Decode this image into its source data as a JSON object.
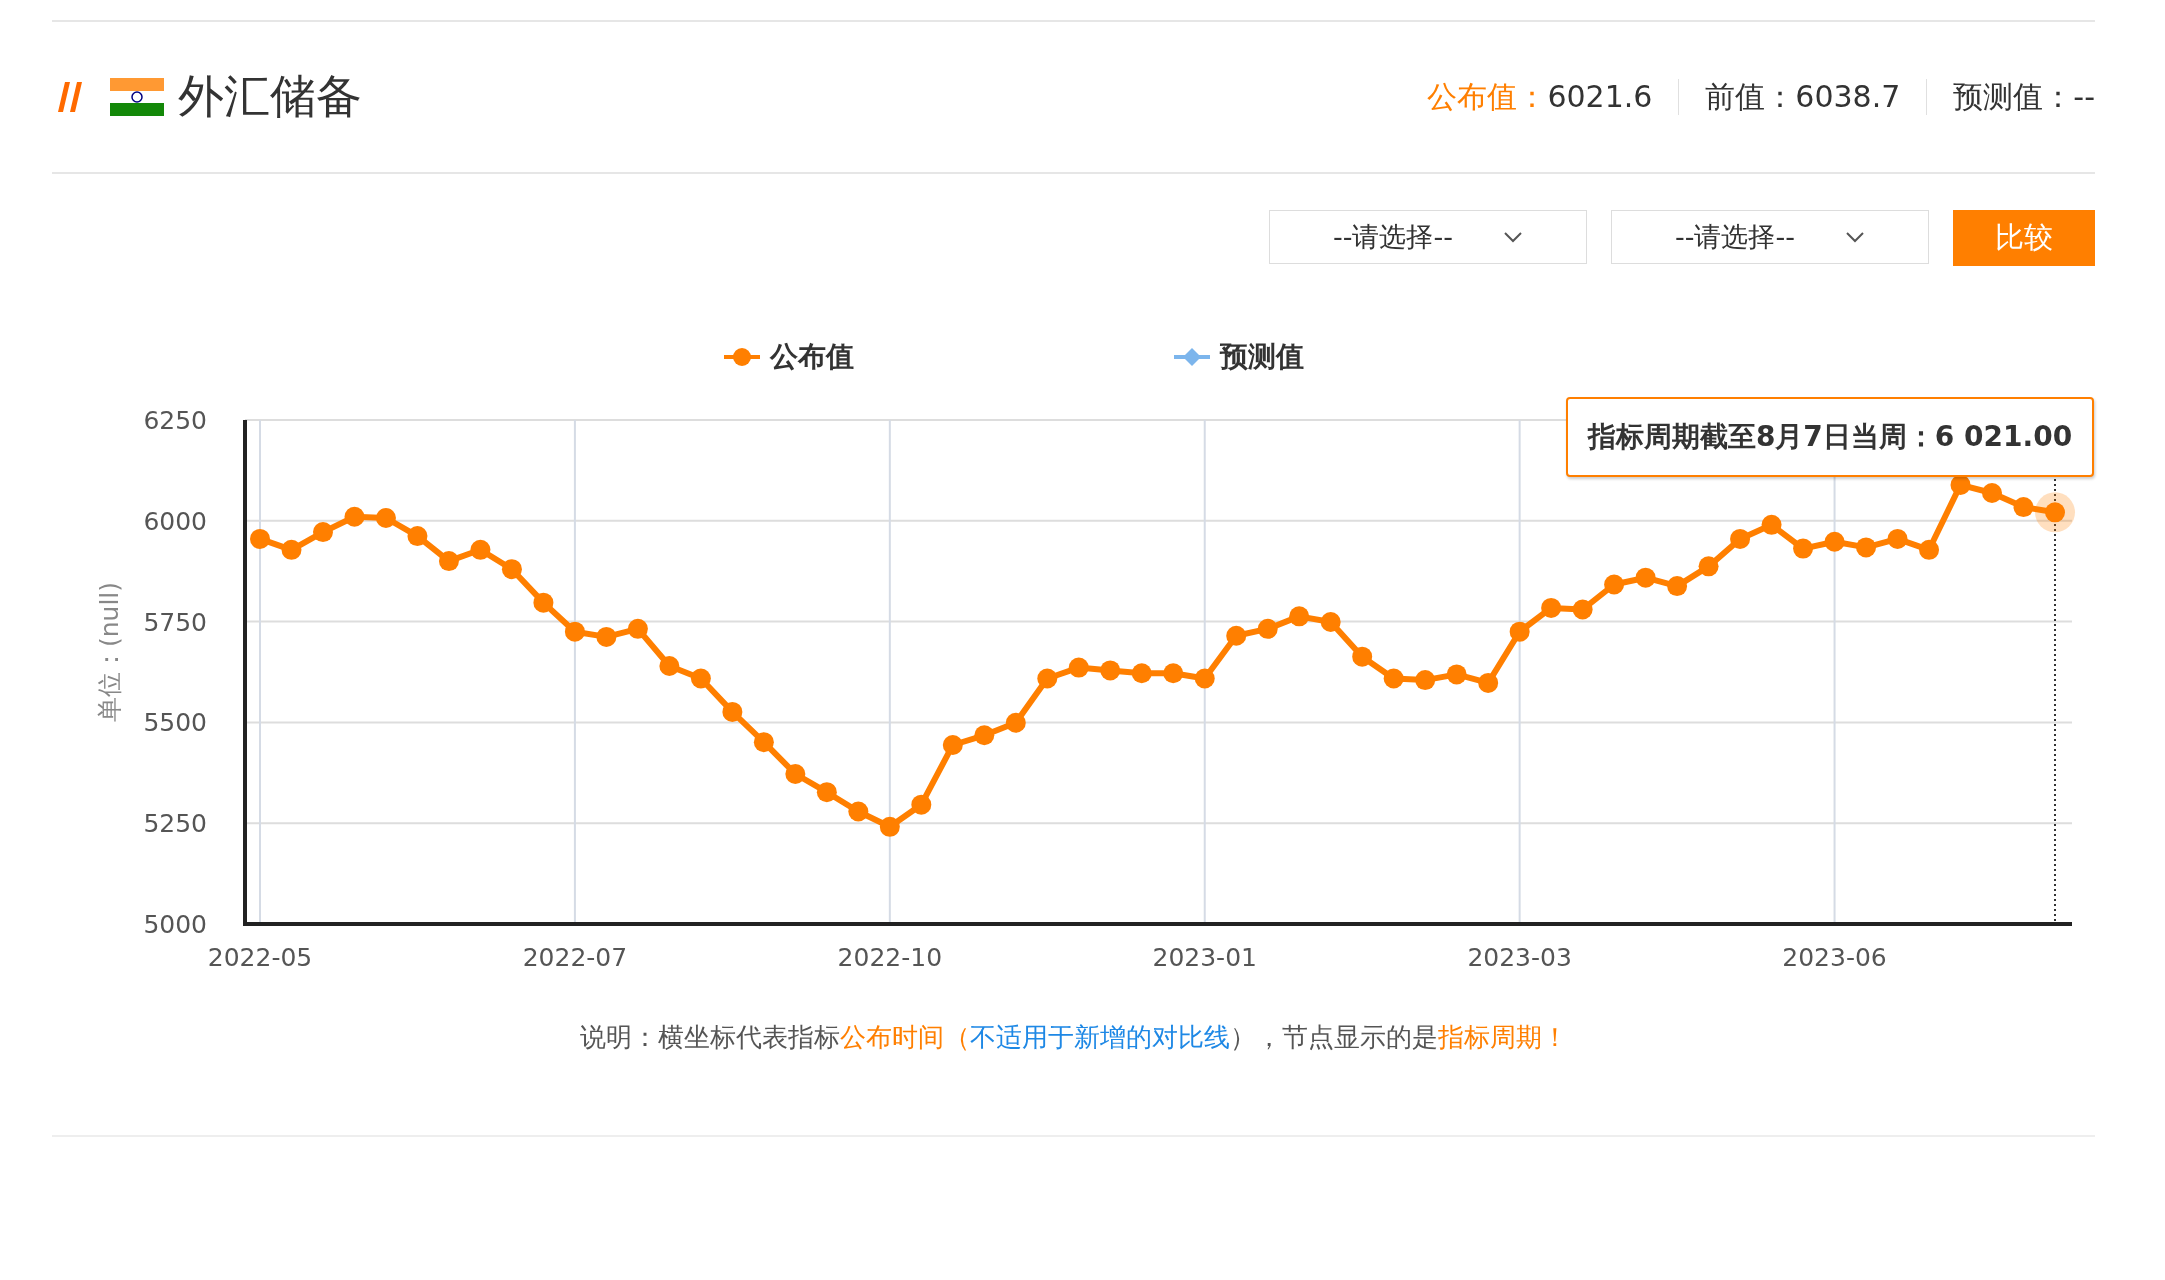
{
  "header": {
    "title": "外汇储备",
    "stats": [
      {
        "label": "公布值：",
        "value": "6021.6",
        "highlight": true
      },
      {
        "label": "前值：",
        "value": "6038.7",
        "highlight": false
      },
      {
        "label": "预测值：",
        "value": "--",
        "highlight": false
      }
    ]
  },
  "controls": {
    "selects": [
      {
        "value": "--请选择--"
      },
      {
        "value": "--请选择--"
      }
    ],
    "button": "比较"
  },
  "chart": {
    "tooltip": "指标周期截至8月7日当周：6 021.00",
    "chart_data": {
      "type": "line",
      "ylabel": "单位：(null)",
      "ylim": [
        5000,
        6250
      ],
      "yticks": [
        5000,
        5250,
        5500,
        5750,
        6000,
        6250
      ],
      "grid": true,
      "categories": [
        "2022-05",
        null,
        null,
        null,
        null,
        null,
        null,
        null,
        null,
        null,
        "2022-07",
        null,
        null,
        null,
        null,
        null,
        null,
        null,
        null,
        null,
        "2022-10",
        null,
        null,
        null,
        null,
        null,
        null,
        null,
        null,
        null,
        "2023-01",
        null,
        null,
        null,
        null,
        null,
        null,
        null,
        null,
        null,
        "2023-03",
        null,
        null,
        null,
        null,
        null,
        null,
        null,
        null,
        null,
        "2023-06",
        null,
        null,
        null,
        null,
        null,
        null,
        null
      ],
      "series": [
        {
          "name": "公布值",
          "color": "#ff7f00",
          "marker": "circle",
          "values": [
            5955,
            5928,
            5972,
            6010,
            6007,
            5962,
            5900,
            5928,
            5880,
            5797,
            5725,
            5712,
            5732,
            5640,
            5609,
            5526,
            5451,
            5372,
            5327,
            5279,
            5241,
            5296,
            5444,
            5468,
            5499,
            5609,
            5636,
            5629,
            5622,
            5622,
            5609,
            5715,
            5732,
            5763,
            5749,
            5663,
            5609,
            5605,
            5619,
            5598,
            5725,
            5784,
            5780,
            5842,
            5859,
            5838,
            5887,
            5955,
            5990,
            5931,
            5948,
            5934,
            5955,
            5928,
            6089,
            6069,
            6034,
            6021
          ]
        },
        {
          "name": "预测值",
          "color": "#7cb5ec",
          "values": [
            null,
            null,
            null,
            null,
            null,
            null,
            null,
            null,
            null,
            null,
            null,
            null,
            null,
            null,
            null,
            null,
            null,
            null,
            null,
            null,
            null,
            null,
            null,
            null,
            null,
            null,
            null,
            null,
            null,
            null,
            null,
            null,
            null,
            null,
            null,
            null,
            null,
            null,
            null,
            null,
            null,
            null,
            null,
            null,
            null,
            null,
            null,
            null,
            null,
            null,
            null,
            null,
            null,
            null,
            null,
            null,
            null,
            null
          ]
        }
      ]
    }
  },
  "note": [
    {
      "kind": "plain",
      "text": "说明：横坐标代表指标"
    },
    {
      "kind": "accent",
      "text": "公布时间（"
    },
    {
      "kind": "link",
      "text": "不适用于新增的对比线"
    },
    {
      "kind": "plain",
      "text": "），节点显示的是"
    },
    {
      "kind": "accent",
      "text": "指标周期！"
    }
  ]
}
